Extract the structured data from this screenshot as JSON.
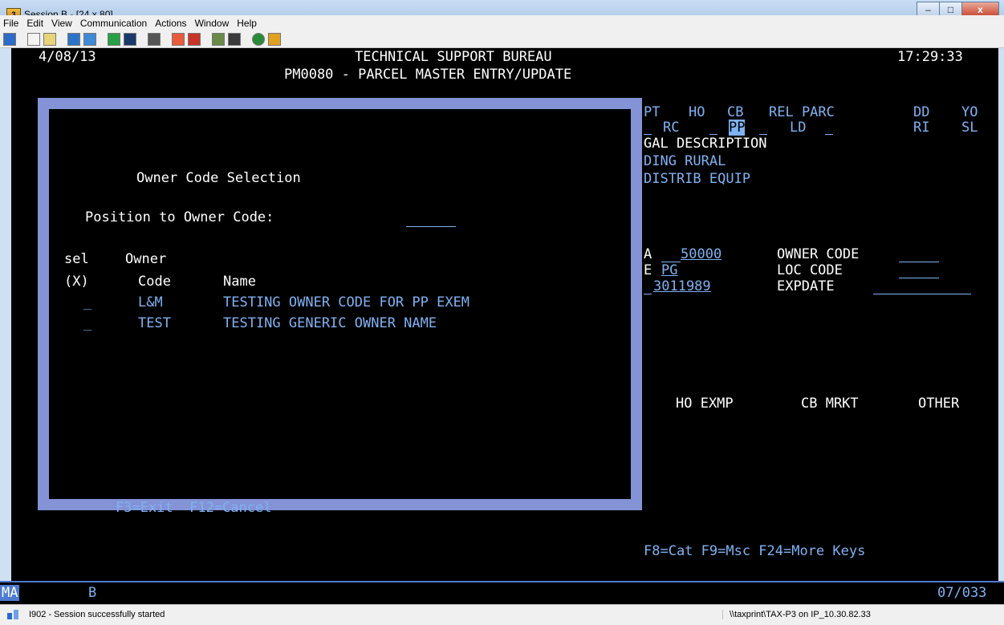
{
  "window": {
    "title": "Session B - [24 x 80]",
    "controls": [
      "–",
      "□",
      "x"
    ]
  },
  "menu": [
    "File",
    "Edit",
    "View",
    "Communication",
    "Actions",
    "Window",
    "Help"
  ],
  "screen": {
    "date": "4/08/13",
    "header1": "TECHNICAL SUPPORT BUREAU",
    "header2": "PM0080 - PARCEL MASTER ENTRY/UPDATE",
    "time": "17:29:33",
    "bg_row1": {
      "pt": "PT",
      "ho": "HO",
      "cb": "CB",
      "rel": "REL PARC",
      "dd": "DD",
      "yo": "YO"
    },
    "bg_row2": {
      "rc": "RC",
      "pp": "PP",
      "ld": "LD",
      "ri": "RI",
      "sl": "SL"
    },
    "legal_desc": "GAL DESCRIPTION",
    "desc1": "DING RURAL",
    "desc2": "DISTRIB EQUIP",
    "row_a": {
      "prefix": "A",
      "value": "50000",
      "owner_code_label": "OWNER CODE"
    },
    "row_e": {
      "prefix": "E",
      "value": "PG",
      "loc_code_label": "LOC CODE"
    },
    "row_date": {
      "value": "3011989",
      "expdate_label": "EXPDATE"
    },
    "exemptions": {
      "ho": "HO EXMP",
      "cb": "CB MRKT",
      "other": "OTHER"
    },
    "fkeys_right": "F8=Cat F9=Msc F24=More Keys"
  },
  "popup": {
    "title": "Owner Code Selection",
    "position_label": "Position to Owner Code:",
    "col_sel_1": "sel",
    "col_sel_2": "(X)",
    "col_owner_1": "Owner",
    "col_owner_2": "Code",
    "col_name": "Name",
    "rows": [
      {
        "sel": "_",
        "code": "L&M",
        "name": "TESTING OWNER CODE FOR PP EXEM"
      },
      {
        "sel": "_",
        "code": "TEST",
        "name": "TESTING GENERIC OWNER NAME"
      }
    ],
    "fkeys": "F3=Exit  F12=Cancel"
  },
  "oia": {
    "left": "MA",
    "session": "B",
    "cursor": "07/033"
  },
  "statusbar": {
    "message": "I902 - Session successfully started",
    "printer": "\\\\taxprint\\TAX-P3 on IP_10.30.82.33"
  },
  "colors": {
    "terminal_bg": "#000000",
    "field_blue": "#7fb2f3",
    "popup_border": "#8393d6"
  }
}
